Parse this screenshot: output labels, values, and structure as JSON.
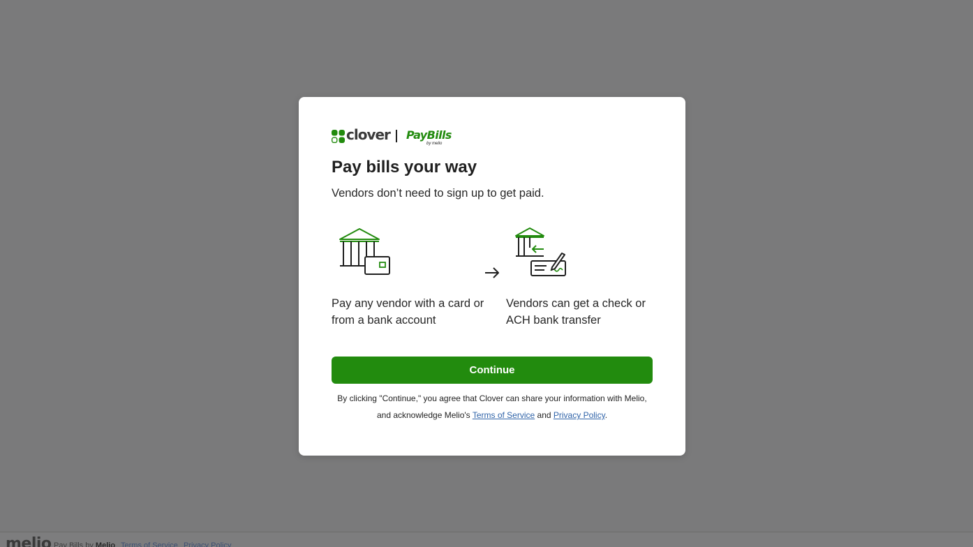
{
  "modal": {
    "brand": {
      "clover": "clover",
      "paybills": "PayBills",
      "by_melio": "by melio"
    },
    "title": "Pay bills your way",
    "subtitle": "Vendors don’t need to sign up to get paid.",
    "features": [
      {
        "icon": "bank-card-icon",
        "text": "Pay any vendor with a card or from a bank account"
      },
      {
        "icon": "bank-check-icon",
        "text": "Vendors can get a check or ACH bank transfer"
      }
    ],
    "continue_label": "Continue",
    "legal": {
      "prefix": "By clicking \"Continue,\" you agree that Clover can share your information with Melio, and acknowledge Melio's",
      "terms": "Terms of Service",
      "and": "and",
      "privacy": "Privacy Policy",
      "suffix": "."
    }
  },
  "footer": {
    "logo": "melio",
    "brand_prefix": "Pay Bills by",
    "brand_name": "Melio",
    "terms": "Terms of Service",
    "privacy": "Privacy Policy"
  },
  "colors": {
    "accent_green": "#228b0e",
    "overlay": "#7a7a7b",
    "link_blue": "#2f63a8"
  }
}
